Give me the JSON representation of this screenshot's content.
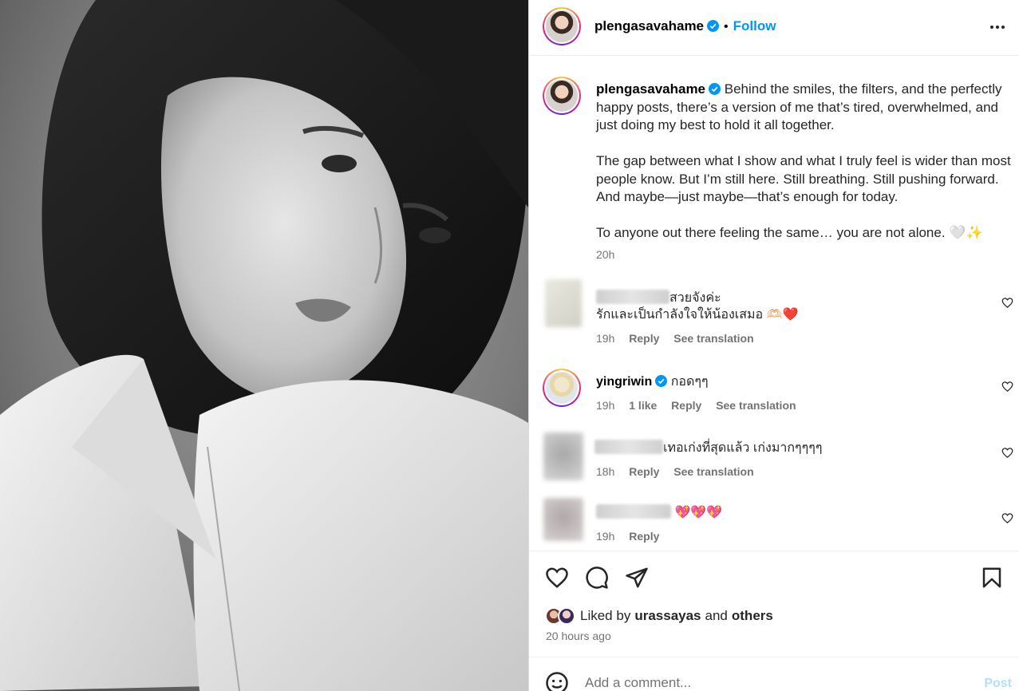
{
  "post": {
    "username": "plengasavahame",
    "follow_label": "Follow",
    "separator": "•"
  },
  "caption": {
    "username": "plengasavahame",
    "paragraphs": [
      "Behind the smiles, the filters, and the perfectly happy posts, there’s a version of me that’s tired, overwhelmed, and just doing my best to hold it all together.",
      "The gap between what I show and what I truly feel is wider than most people know. But I’m still here. Still breathing. Still pushing forward. And maybe—just maybe—that’s enough for today.",
      "To anyone out there feeling the same… you are not alone. 🤍✨"
    ],
    "time": "20h"
  },
  "comments": [
    {
      "username_blurred": true,
      "text_line1": "สวยจังค่ะ",
      "text_line2": "รักและเป็นกำลังใจให้น้องเสมอ 🫶🏻❤️",
      "time": "19h",
      "reply": "Reply",
      "translate": "See translation"
    },
    {
      "username": "yingriwin",
      "verified": true,
      "text": "กอดๆๆ",
      "time": "19h",
      "likes": "1 like",
      "reply": "Reply",
      "translate": "See translation"
    },
    {
      "username_blurred": true,
      "text": "เทอเก่งที่สุดแล้ว เก่งมากๆๆๆๆ",
      "time": "18h",
      "reply": "Reply",
      "translate": "See translation"
    },
    {
      "username_blurred": true,
      "text": "💖💖💖",
      "time": "19h",
      "reply": "Reply"
    }
  ],
  "actions": {
    "icons": [
      "heart-icon",
      "comment-icon",
      "share-icon",
      "bookmark-icon"
    ]
  },
  "likes": {
    "prefix": "Liked by",
    "user": "urassayas",
    "joiner": "and",
    "others": "others",
    "time_ago": "20 hours ago"
  },
  "add_comment": {
    "placeholder": "Add a comment...",
    "post_label": "Post"
  },
  "colors": {
    "accent": "#0095f6",
    "muted": "#737373",
    "text": "#262626",
    "post_disabled": "#b2dffc"
  }
}
